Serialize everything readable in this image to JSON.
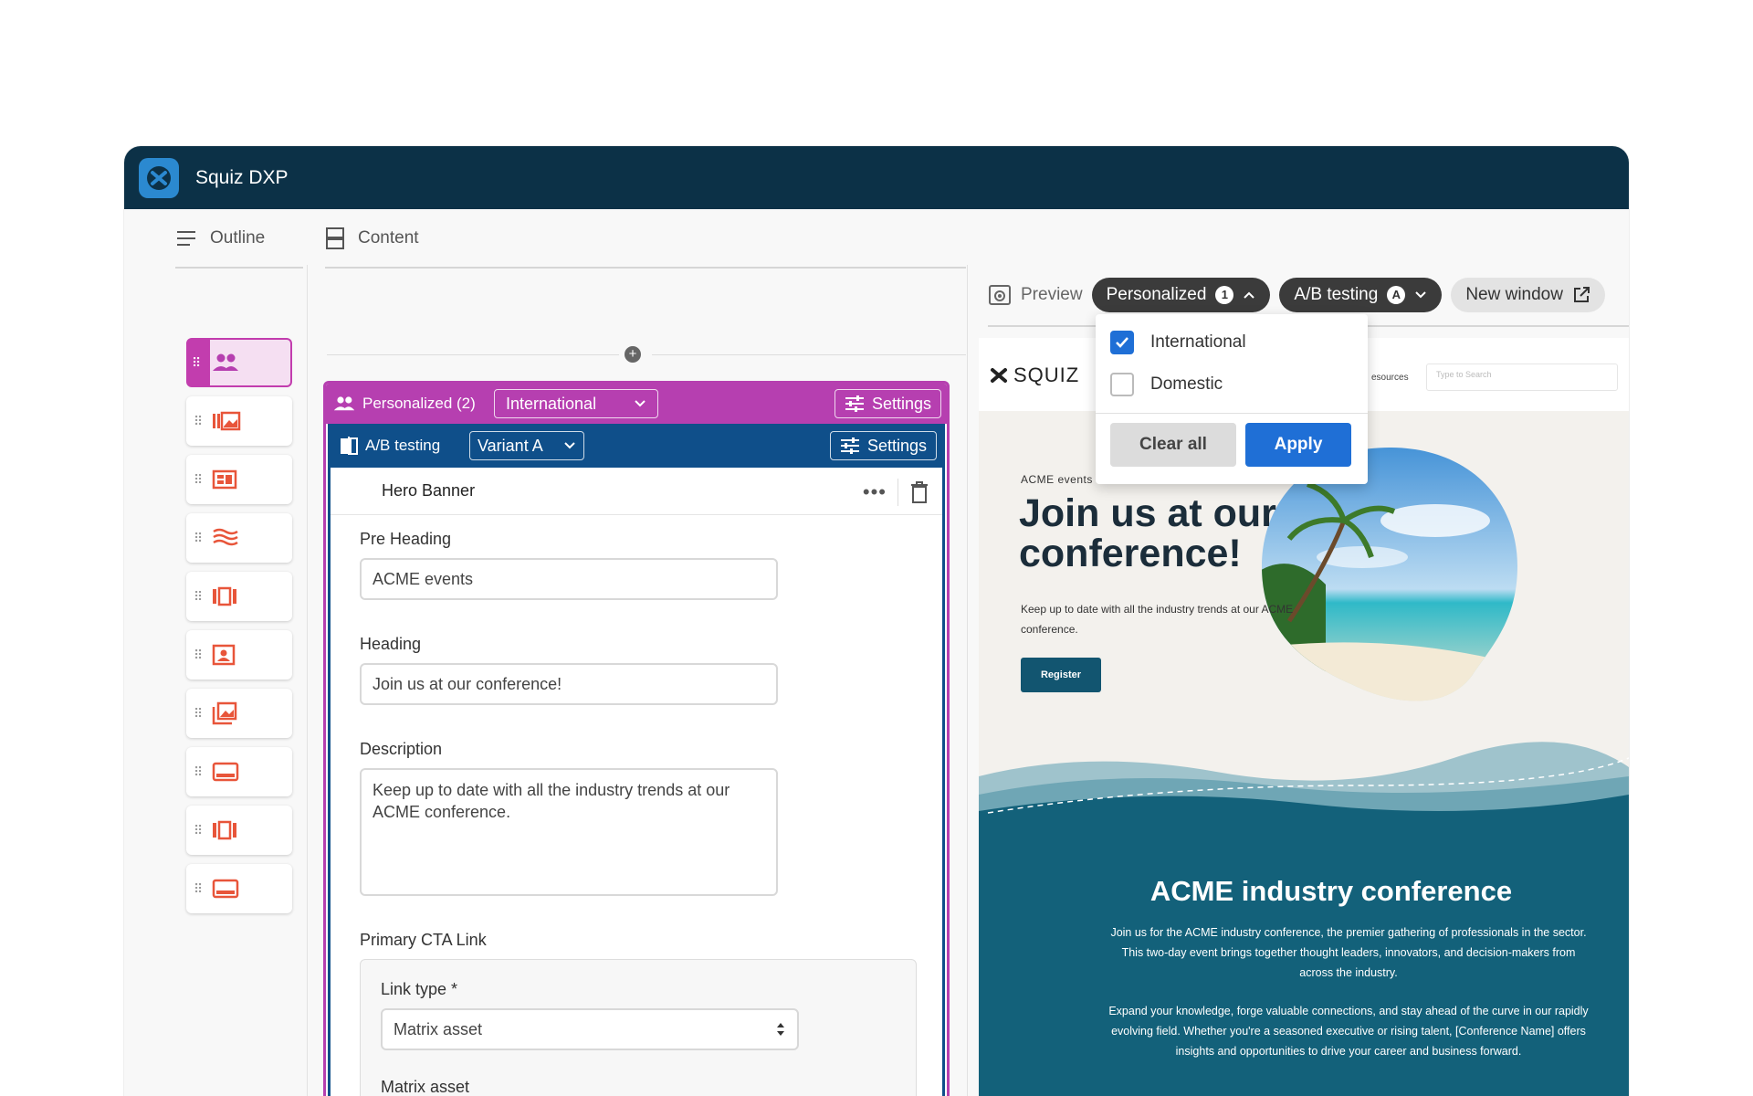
{
  "app": {
    "title": "Squiz DXP"
  },
  "outline": {
    "heading": "Outline",
    "items": [
      {
        "icon": "people-icon",
        "active": true
      },
      {
        "icon": "gallery-icon"
      },
      {
        "icon": "layout-icon"
      },
      {
        "icon": "wave-icon"
      },
      {
        "icon": "carousel-icon"
      },
      {
        "icon": "profile-card-icon"
      },
      {
        "icon": "image-stack-icon"
      },
      {
        "icon": "banner-icon"
      },
      {
        "icon": "carousel-icon"
      },
      {
        "icon": "banner-icon"
      }
    ]
  },
  "content": {
    "heading": "Content",
    "personalized": {
      "label": "Personalized (2)",
      "segment": "International",
      "settings": "Settings"
    },
    "ab": {
      "label": "A/B testing",
      "variant": "Variant A",
      "settings": "Settings"
    },
    "component": {
      "title": "Hero Banner",
      "pre_heading_label": "Pre Heading",
      "pre_heading_value": "ACME events",
      "heading_label": "Heading",
      "heading_value": "Join us at our conference!",
      "description_label": "Description",
      "description_value": "Keep up to date with all the industry trends at our ACME conference.",
      "cta_label": "Primary CTA Link",
      "link_type_label": "Link type *",
      "link_type_value": "Matrix asset",
      "matrix_asset_label": "Matrix asset"
    }
  },
  "preview": {
    "heading": "Preview",
    "personalized_label": "Personalized",
    "personalized_count": "1",
    "ab_label": "A/B testing",
    "ab_badge": "A",
    "new_window": "New window",
    "dropdown": {
      "options": [
        {
          "label": "International",
          "checked": true
        },
        {
          "label": "Domestic",
          "checked": false
        }
      ],
      "clear": "Clear all",
      "apply": "Apply"
    },
    "site": {
      "logo": "SQUIZ",
      "nav_resources": "esources",
      "search_placeholder": "Type to Search",
      "pre_heading": "ACME events",
      "title": "Join us at our conference!",
      "description": "Keep up to date with all the industry trends at our ACME conference.",
      "register": "Register",
      "conf_title": "ACME industry conference",
      "conf_p1": "Join us for the ACME industry conference, the premier gathering of professionals in the sector. This two-day event brings together thought leaders, innovators, and decision-makers from across the industry.",
      "conf_p2": "Expand your knowledge, forge valuable connections, and stay ahead of the curve in our rapidly evolving field. Whether you're a seasoned executive or rising talent, [Conference Name] offers insights and opportunities to drive your career and business forward."
    }
  },
  "colors": {
    "titlebar": "#0c3147",
    "personalized": "#b63fb0",
    "ab": "#0f4f8a",
    "apply": "#1f6fd6",
    "site_band": "#13617a"
  }
}
